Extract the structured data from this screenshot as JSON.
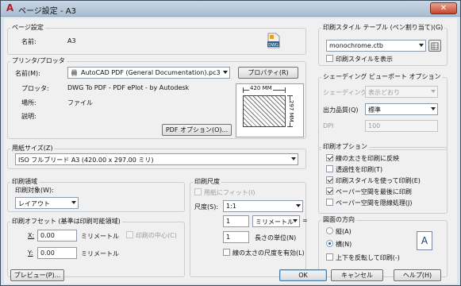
{
  "title": "ページ設定 - A3",
  "close_label": "✕",
  "page_setup": {
    "group_label": "ページ設定",
    "name_label": "名前:",
    "name_value": "A3",
    "dwg_icon_text": "DWG"
  },
  "printer": {
    "group_label": "プリンタ/プロッタ",
    "name_label": "名前(M):",
    "name_value": "AutoCAD PDF (General Documentation).pc3",
    "properties_label": "プロパティ(R)",
    "plotter_label": "プロッタ:",
    "plotter_value": "DWG To PDF - PDF ePlot - by Autodesk",
    "location_label": "場所:",
    "location_value": "ファイル",
    "description_label": "説明:",
    "pdf_options_label": "PDF オプション(O)...",
    "preview_width": "420 MM",
    "preview_height": "297 MM"
  },
  "paper_size": {
    "group_label": "用紙サイズ(Z)",
    "value": "ISO フルブリード A3 (420.00 x 297.00 ミリ)"
  },
  "plot_area": {
    "group_label": "印刷領域",
    "what_label": "印刷対象(W):",
    "what_value": "レイアウト"
  },
  "plot_offset": {
    "group_label": "印刷オフセット (基準は印刷可能領域)",
    "x_label": "X:",
    "x_value": "0.00",
    "x_unit": "ミリメートル",
    "y_label": "Y:",
    "y_value": "0.00",
    "y_unit": "ミリメートル",
    "center_label": "印刷の中心(C)"
  },
  "plot_scale": {
    "group_label": "印刷尺度",
    "fit_label": "用紙にフィット(I)",
    "scale_label": "尺度(S):",
    "scale_value": "1:1",
    "num_value": "1",
    "unit_value": "ミリメートル",
    "equals": "=",
    "den_value": "1",
    "units_label": "長さの単位(N)",
    "lineweights_label": "線の太さの尺度を有効(L)"
  },
  "plot_style": {
    "group_label": "印刷スタイル テーブル (ペン割り当て)(G)",
    "value": "monochrome.ctb",
    "display_label": "印刷スタイルを表示"
  },
  "shaded": {
    "group_label": "シェーディング ビューポート オプション",
    "shade_label": "シェーディング(D)",
    "shade_value": "表示どおり",
    "quality_label": "出力品質(Q)",
    "quality_value": "標準",
    "dpi_label": "DPI",
    "dpi_value": "100"
  },
  "plot_options": {
    "group_label": "印刷オプション",
    "items": [
      {
        "label": "線の太さを印刷に反映",
        "checked": true
      },
      {
        "label": "透過性を印刷(T)",
        "checked": false
      },
      {
        "label": "印刷スタイルを使って印刷(E)",
        "checked": true
      },
      {
        "label": "ペーパー空間を最後に印刷",
        "checked": true
      },
      {
        "label": "ペーパー空間を隠線処理(J)",
        "checked": false
      }
    ]
  },
  "orientation": {
    "group_label": "図面の方向",
    "portrait_label": "縦(A)",
    "landscape_label": "横(N)",
    "upside_down_label": "上下を反転して印刷(-)",
    "icon_letter": "A"
  },
  "buttons": {
    "preview": "プレビュー(P)...",
    "ok": "OK",
    "cancel": "キャンセル",
    "help": "ヘルプ(H)"
  }
}
